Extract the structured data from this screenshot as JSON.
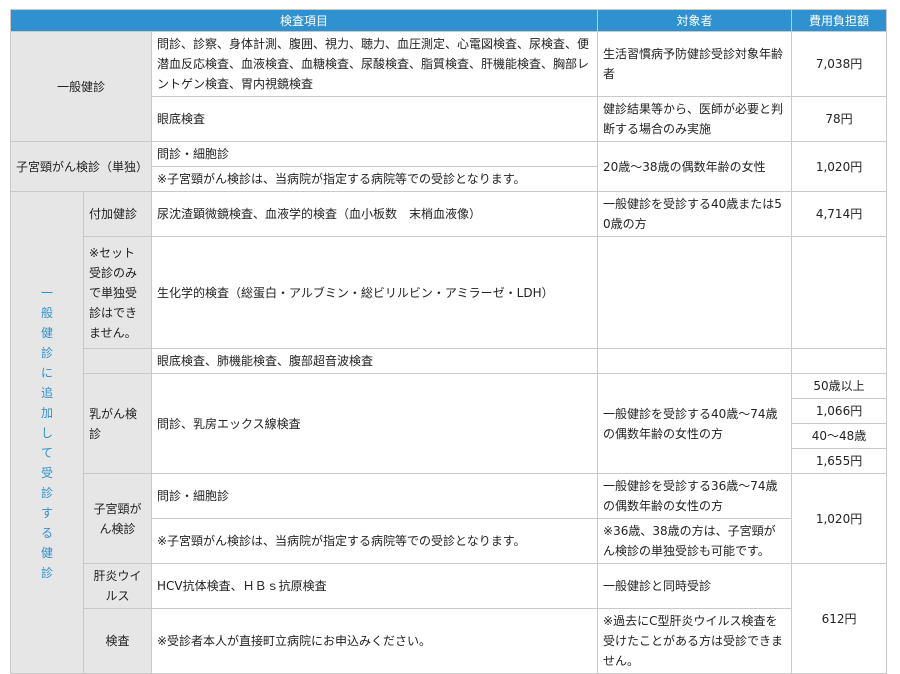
{
  "headers": {
    "item": "検査項目",
    "target": "対象者",
    "cost": "費用負担額"
  },
  "general": {
    "label": "一般健診",
    "items1": "問診、診察、身体計測、腹囲、視力、聴力、血圧測定、心電図検査、尿検査、便潜血反応検査、血液検査、血糖検査、尿酸検査、脂質検査、肝機能検査、胸部レントゲン検査、胃内視鏡検査",
    "target1": "生活習慣病予防健診受診対象年齢者",
    "cost1": "7,038円",
    "items2": "眼底検査",
    "target2": "健診結果等から、医師が必要と判断する場合のみ実施",
    "cost2": "78円"
  },
  "cervical_single": {
    "label": "子宮頸がん検診（単独）",
    "items1": "問診・細胞診",
    "items2": "※子宮頸がん検診は、当病院が指定する病院等での受診となります。",
    "target": "20歳～38歳の偶数年齢の女性",
    "cost": "1,020円"
  },
  "additional": {
    "vertical_label": "一般健診に追加して受診する健診",
    "addon": {
      "label": "付加健診",
      "items": "尿沈渣顕微鏡検査、血液学的検査（血小板数　末梢血液像）",
      "target": "一般健診を受診する40歳または50歳の方",
      "cost": "4,714円"
    },
    "set_note": "※セット受診のみで単独受診はできません。",
    "biochem": "生化学的検査（総蛋白・アルブミン・総ビリルビン・アミラーゼ・LDH）",
    "fundus": "眼底検査、肺機能検査、腹部超音波検査",
    "breast": {
      "label": "乳がん検診",
      "items": "問診、乳房エックス線検査",
      "target": "一般健診を受診する40歳～74歳の偶数年齢の女性の方",
      "age1": "50歳以上",
      "cost1": "1,066円",
      "age2": "40～48歳",
      "cost2": "1,655円"
    },
    "cervical": {
      "label": "子宮頸がん検診",
      "items1": "問診・細胞診",
      "target1": "一般健診を受診する36歳～74歳の偶数年齢の女性の方",
      "items2": "※子宮頸がん検診は、当病院が指定する病院等での受診となります。",
      "target2": "※36歳、38歳の方は、子宮頸がん検診の単独受診も可能です。",
      "cost": "1,020円"
    },
    "hepatitis": {
      "label1": "肝炎ウイルス",
      "label2": "検査",
      "items1": "HCV抗体検査、ＨＢｓ抗原検査",
      "target1": "一般健診と同時受診",
      "items2": "※受診者本人が直接町立病院にお申込みください。",
      "target2": "※過去にC型肝炎ウイルス検査を受けたことがある方は受診できません。",
      "cost": "612円"
    }
  }
}
